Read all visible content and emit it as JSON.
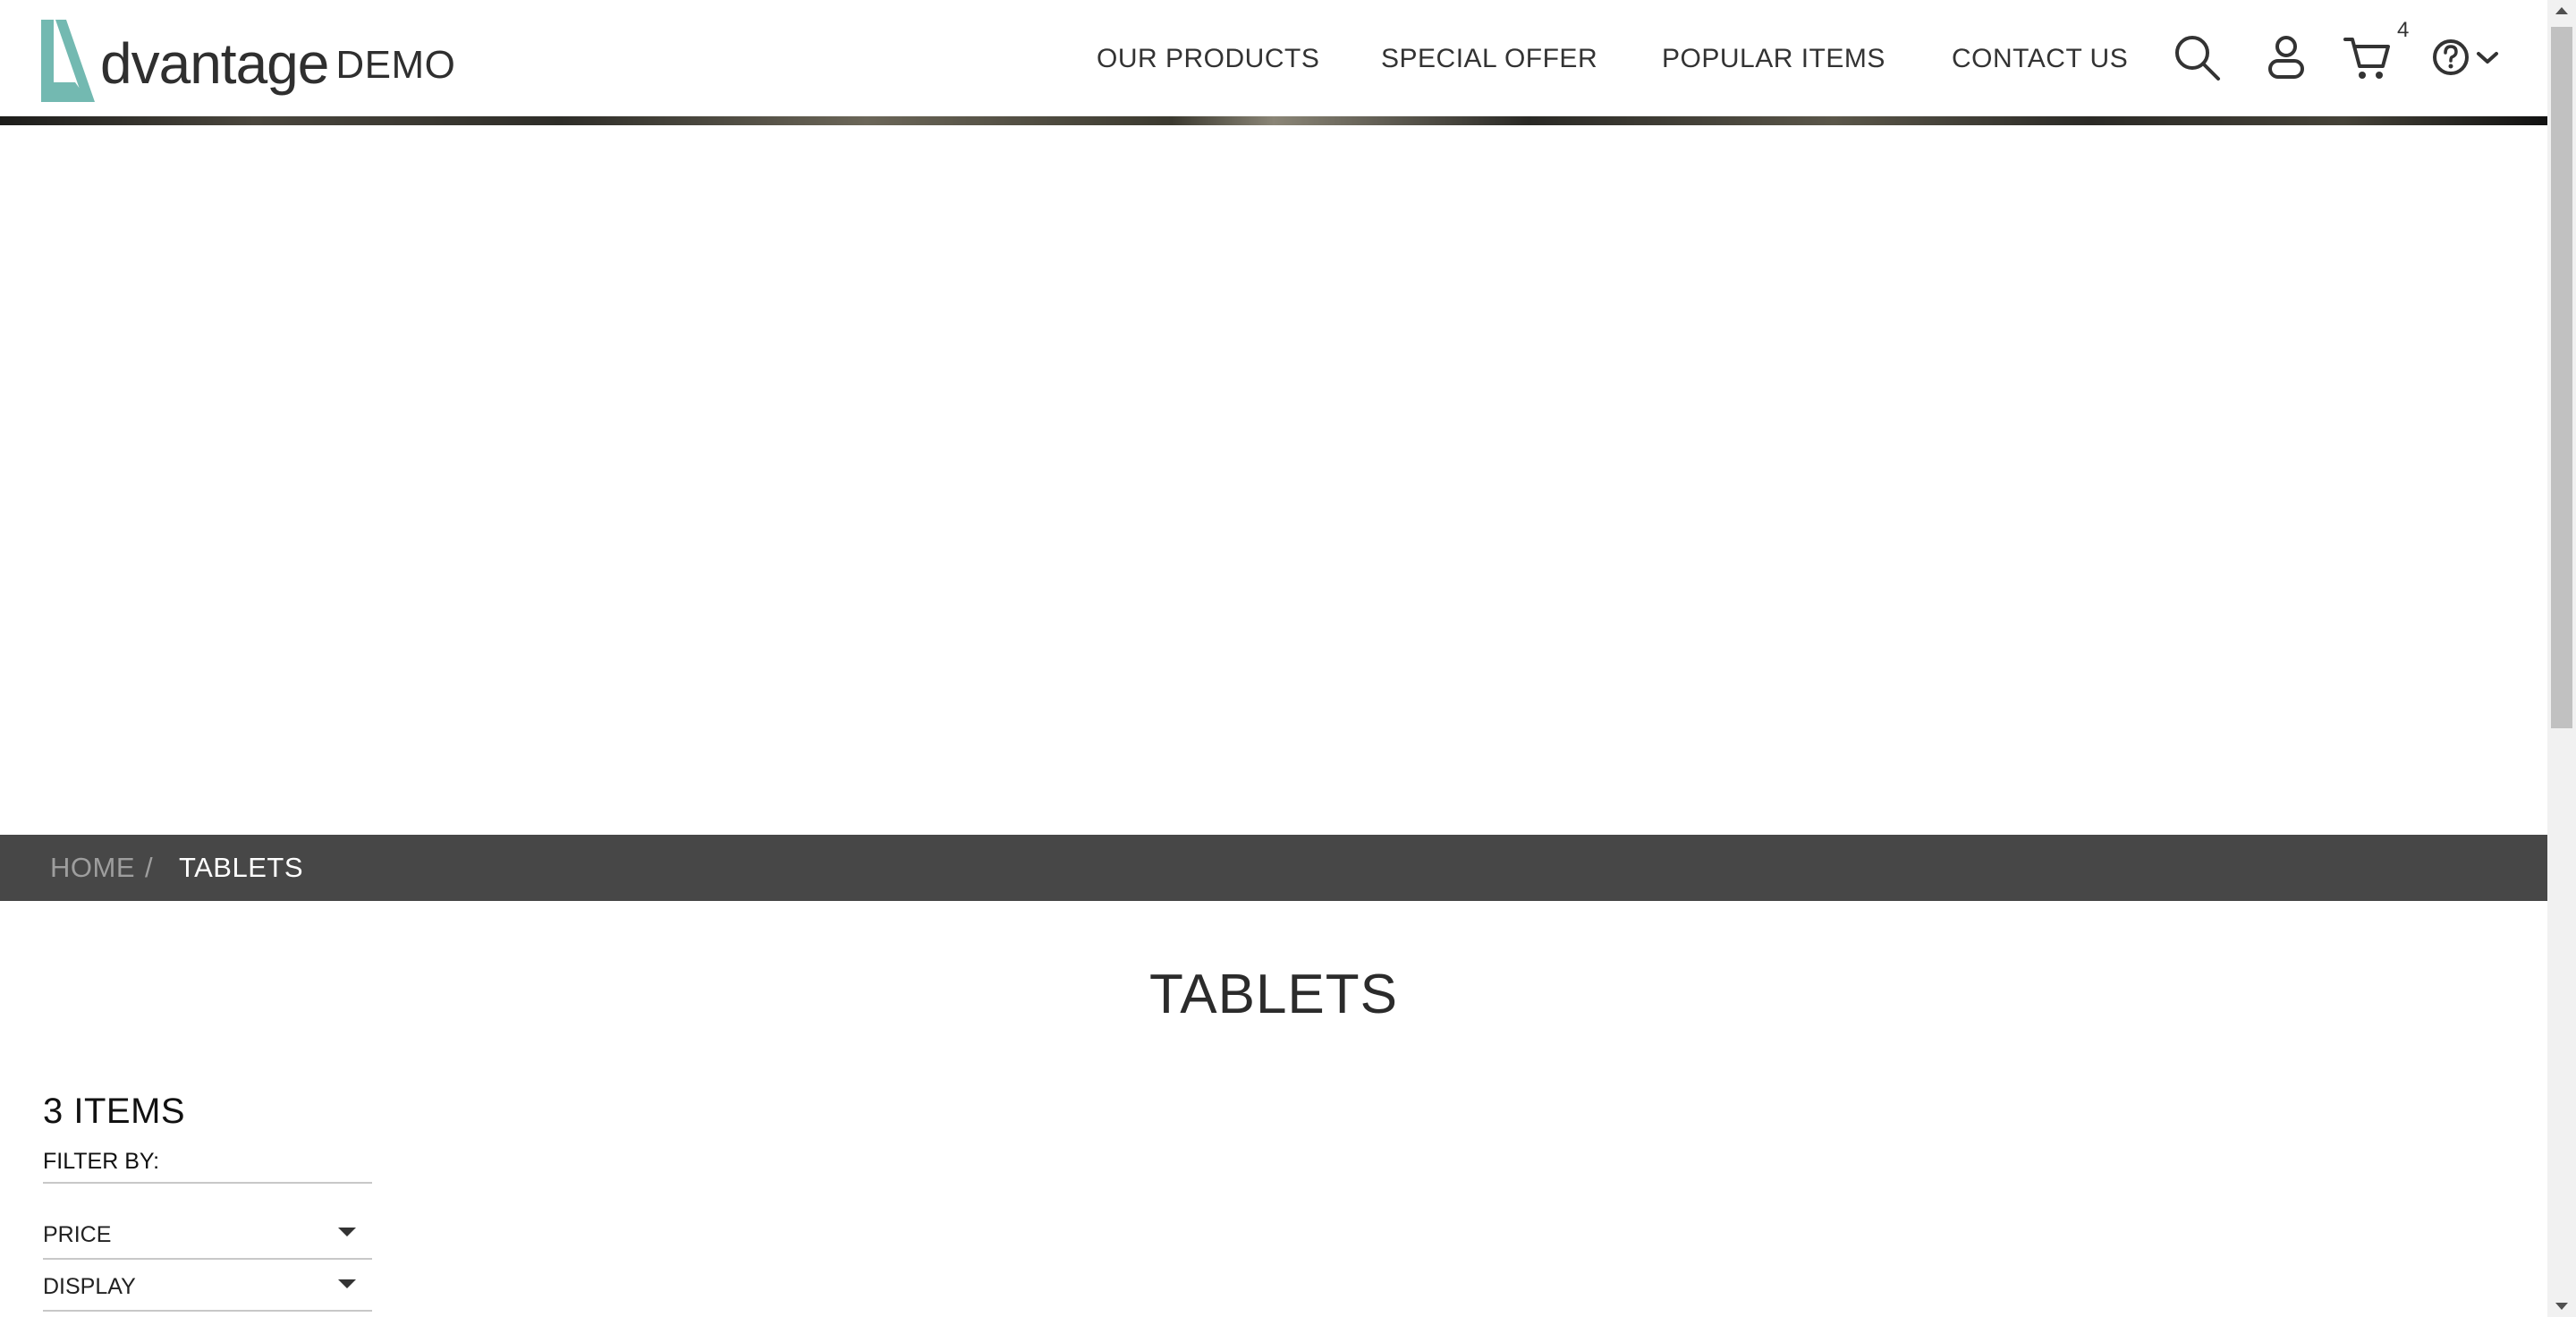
{
  "header": {
    "logo_word": "dvantage",
    "logo_demo": "DEMO",
    "nav": [
      {
        "label": "OUR PRODUCTS"
      },
      {
        "label": "SPECIAL OFFER"
      },
      {
        "label": "POPULAR ITEMS"
      },
      {
        "label": "CONTACT US"
      }
    ],
    "cart_count": "4",
    "icons": [
      "search-icon",
      "user-icon",
      "cart-icon",
      "help-icon",
      "chevron-down-icon"
    ],
    "accent_color": "#73b9b1"
  },
  "breadcrumb": {
    "home": "HOME",
    "separator": "/",
    "current": "TABLETS"
  },
  "page_title": "TABLETS",
  "filters": {
    "items_count": "3 ITEMS",
    "filter_by": "FILTER BY:",
    "groups": [
      {
        "label": "PRICE"
      },
      {
        "label": "DISPLAY"
      }
    ]
  }
}
